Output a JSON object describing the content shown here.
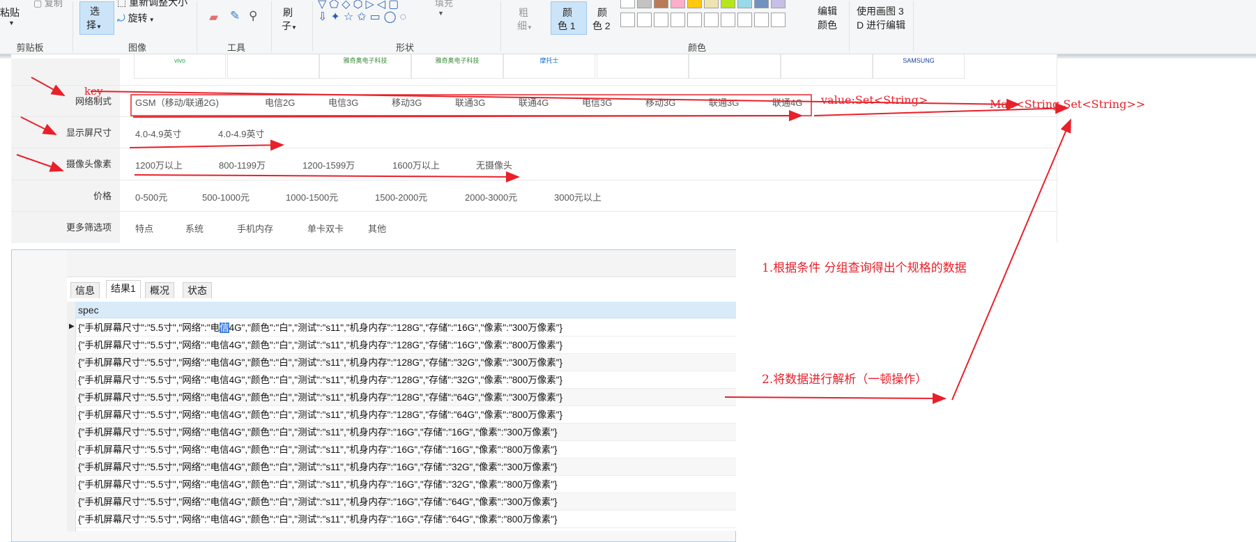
{
  "ribbon": {
    "clipboard": {
      "paste": "粘贴",
      "copy": "复制",
      "group": "剪贴板"
    },
    "image": {
      "select": "选",
      "select2": "择",
      "resize": "重新调整大小",
      "rotate": "旋转",
      "group": "图像"
    },
    "tools": {
      "group": "工具"
    },
    "brush": {
      "label1": "刷",
      "label2": "子"
    },
    "shapes": {
      "group": "形状",
      "fill": "填充"
    },
    "size": {
      "label1": "粗",
      "label2": "细"
    },
    "color1": {
      "label1": "颜",
      "label2": "色 1"
    },
    "color2": {
      "label1": "颜",
      "label2": "色 2"
    },
    "colors_group": "颜色",
    "edit_colors": {
      "label1": "编辑",
      "label2": "颜色"
    },
    "paint3d": {
      "label1": "使用画图 3",
      "label2": "D 进行编辑"
    },
    "swatches_top": [
      "#ffffff",
      "#c3c3c3",
      "#b97a57",
      "#ffaec9",
      "#ffc90e",
      "#efe4b0",
      "#b5e61d",
      "#99d9ea",
      "#7092be",
      "#c8bfe7"
    ]
  },
  "filter": {
    "logos": [
      "vivo",
      "",
      "雅奇奥电子科技",
      "雅奇奥电子科技",
      "摩托士",
      "",
      "",
      "",
      "SAMSUNG"
    ],
    "rows": [
      {
        "label": "网络制式",
        "options": [
          "GSM（移动/联通2G)",
          "电信2G",
          "电信3G",
          "移动3G",
          "联通3G",
          "联通4G",
          "电信3G",
          "移动3G",
          "联通3G",
          "联通4G"
        ]
      },
      {
        "label": "显示屏尺寸",
        "options": [
          "4.0-4.9英寸",
          "4.0-4.9英寸"
        ]
      },
      {
        "label": "摄像头像素",
        "options": [
          "1200万以上",
          "800-1199万",
          "1200-1599万",
          "1600万以上",
          "无摄像头"
        ]
      },
      {
        "label": "价格",
        "options": [
          "0-500元",
          "500-1000元",
          "1000-1500元",
          "1500-2000元",
          "2000-3000元",
          "3000元以上"
        ]
      },
      {
        "label": "更多筛选项",
        "options": [
          "特点",
          "系统",
          "手机内存",
          "单卡双卡",
          "其他"
        ]
      }
    ]
  },
  "result": {
    "tabs": [
      "信息",
      "结果1",
      "概况",
      "状态"
    ],
    "active_tab": "结果1",
    "column": "spec",
    "row1_prefix": "{\"手机屏幕尺寸\":\"5.5寸\",\"网络\":\"电",
    "row1_hl": "信",
    "row1_suffix": "4G\",\"颜色\":\"白\",\"测试\":\"s11\",\"机身内存\":\"128G\",\"存储\":\"16G\",\"像素\":\"300万像素\"}",
    "rows": [
      "{\"手机屏幕尺寸\":\"5.5寸\",\"网络\":\"电信4G\",\"颜色\":\"白\",\"测试\":\"s11\",\"机身内存\":\"128G\",\"存储\":\"16G\",\"像素\":\"800万像素\"}",
      "{\"手机屏幕尺寸\":\"5.5寸\",\"网络\":\"电信4G\",\"颜色\":\"白\",\"测试\":\"s11\",\"机身内存\":\"128G\",\"存储\":\"32G\",\"像素\":\"300万像素\"}",
      "{\"手机屏幕尺寸\":\"5.5寸\",\"网络\":\"电信4G\",\"颜色\":\"白\",\"测试\":\"s11\",\"机身内存\":\"128G\",\"存储\":\"32G\",\"像素\":\"800万像素\"}",
      "{\"手机屏幕尺寸\":\"5.5寸\",\"网络\":\"电信4G\",\"颜色\":\"白\",\"测试\":\"s11\",\"机身内存\":\"128G\",\"存储\":\"64G\",\"像素\":\"300万像素\"}",
      "{\"手机屏幕尺寸\":\"5.5寸\",\"网络\":\"电信4G\",\"颜色\":\"白\",\"测试\":\"s11\",\"机身内存\":\"128G\",\"存储\":\"64G\",\"像素\":\"800万像素\"}",
      "{\"手机屏幕尺寸\":\"5.5寸\",\"网络\":\"电信4G\",\"颜色\":\"白\",\"测试\":\"s11\",\"机身内存\":\"16G\",\"存储\":\"16G\",\"像素\":\"300万像素\"}",
      "{\"手机屏幕尺寸\":\"5.5寸\",\"网络\":\"电信4G\",\"颜色\":\"白\",\"测试\":\"s11\",\"机身内存\":\"16G\",\"存储\":\"16G\",\"像素\":\"800万像素\"}",
      "{\"手机屏幕尺寸\":\"5.5寸\",\"网络\":\"电信4G\",\"颜色\":\"白\",\"测试\":\"s11\",\"机身内存\":\"16G\",\"存储\":\"32G\",\"像素\":\"300万像素\"}",
      "{\"手机屏幕尺寸\":\"5.5寸\",\"网络\":\"电信4G\",\"颜色\":\"白\",\"测试\":\"s11\",\"机身内存\":\"16G\",\"存储\":\"32G\",\"像素\":\"800万像素\"}",
      "{\"手机屏幕尺寸\":\"5.5寸\",\"网络\":\"电信4G\",\"颜色\":\"白\",\"测试\":\"s11\",\"机身内存\":\"16G\",\"存储\":\"64G\",\"像素\":\"300万像素\"}",
      "{\"手机屏幕尺寸\":\"5.5寸\",\"网络\":\"电信4G\",\"颜色\":\"白\",\"测试\":\"s11\",\"机身内存\":\"16G\",\"存储\":\"64G\",\"像素\":\"800万像素\"}"
    ]
  },
  "annotations": {
    "key": "key",
    "value": "value:Set<String>",
    "map": "Map<String,Set<String>>",
    "step1": "1.根据条件 分组查询得出个规格的数据",
    "step2": "2.将数据进行解析（一顿操作）",
    "color": "#e8202a"
  }
}
